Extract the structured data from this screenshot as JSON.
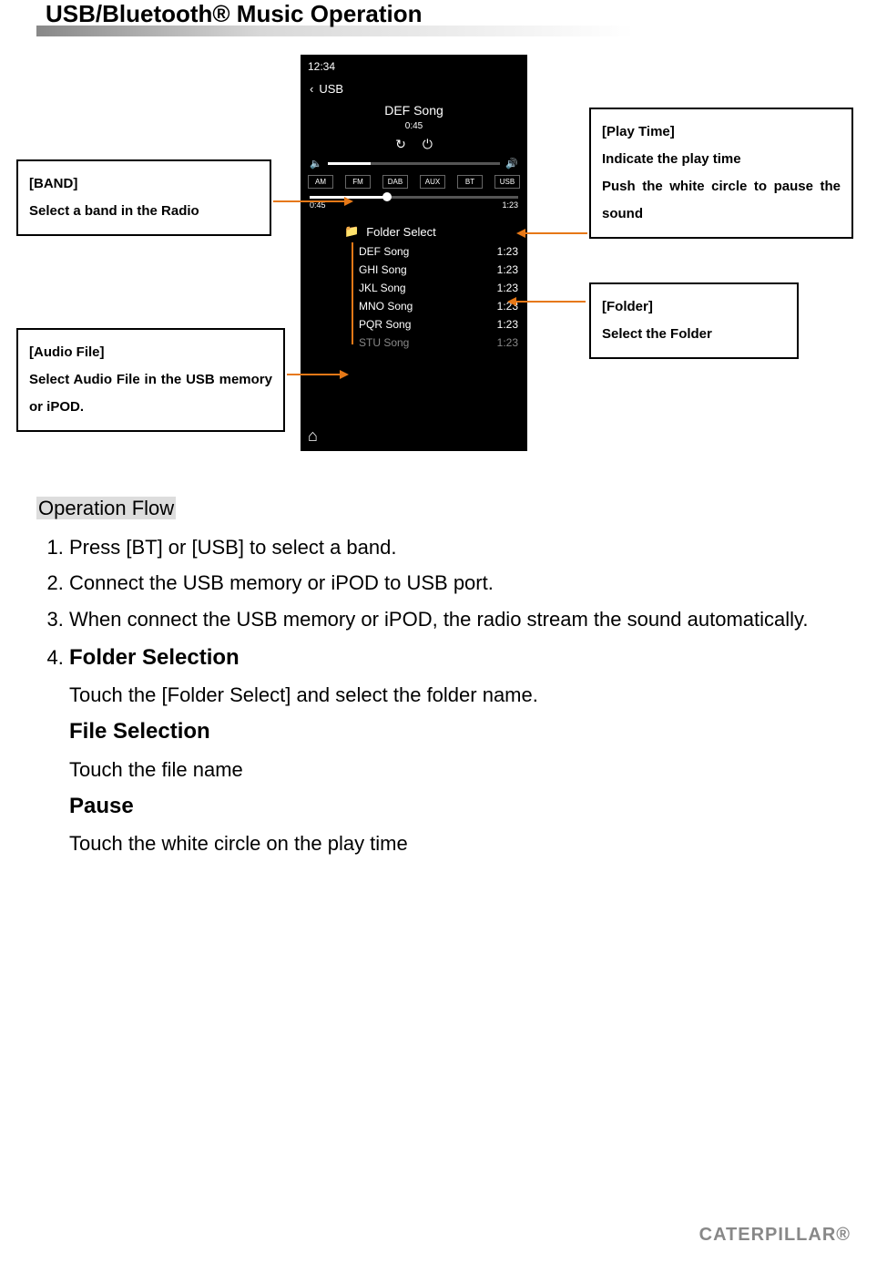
{
  "page": {
    "title": "USB/Bluetooth®  Music Operation"
  },
  "phone": {
    "clock": "12:34",
    "back_label": "USB",
    "now_playing": "DEF Song",
    "elapsed": "0:45",
    "bands": [
      "AM",
      "FM",
      "DAB",
      "AUX",
      "BT",
      "USB"
    ],
    "progress": {
      "current": "0:45",
      "total": "1:23"
    },
    "folder_label": "Folder Select",
    "songs": [
      {
        "name": "DEF Song",
        "time": "1:23"
      },
      {
        "name": "GHI Song",
        "time": "1:23"
      },
      {
        "name": "JKL Song",
        "time": "1:23"
      },
      {
        "name": "MNO Song",
        "time": "1:23"
      },
      {
        "name": "PQR Song",
        "time": "1:23"
      },
      {
        "name": "STU Song",
        "time": "1:23"
      }
    ]
  },
  "callouts": {
    "band": {
      "title": "[BAND]",
      "desc": "Select a band in the Radio"
    },
    "audio": {
      "title": "[Audio File]",
      "desc": "Select Audio File in the USB memory or iPOD."
    },
    "playtime": {
      "title": "[Play Time]",
      "line1": "Indicate the play time",
      "line2": "Push the white circle to pause the sound"
    },
    "folder": {
      "title": "[Folder]",
      "desc": "Select the Folder"
    }
  },
  "opflow": {
    "heading": "Operation Flow",
    "step1": "Press [BT] or [USB] to select a band.",
    "step2": "Connect the USB memory or iPOD to USB port.",
    "step3": "When connect the USB memory or iPOD, the radio stream the sound automatically.",
    "step4": {
      "h1": "Folder Selection",
      "t1": "Touch the [Folder Select] and select the folder name.",
      "h2": "File Selection",
      "t2": "Touch the file name",
      "h3": "Pause",
      "t3": "Touch the white circle on the play time"
    }
  },
  "footer": {
    "brand": "CATERPILLAR®"
  }
}
